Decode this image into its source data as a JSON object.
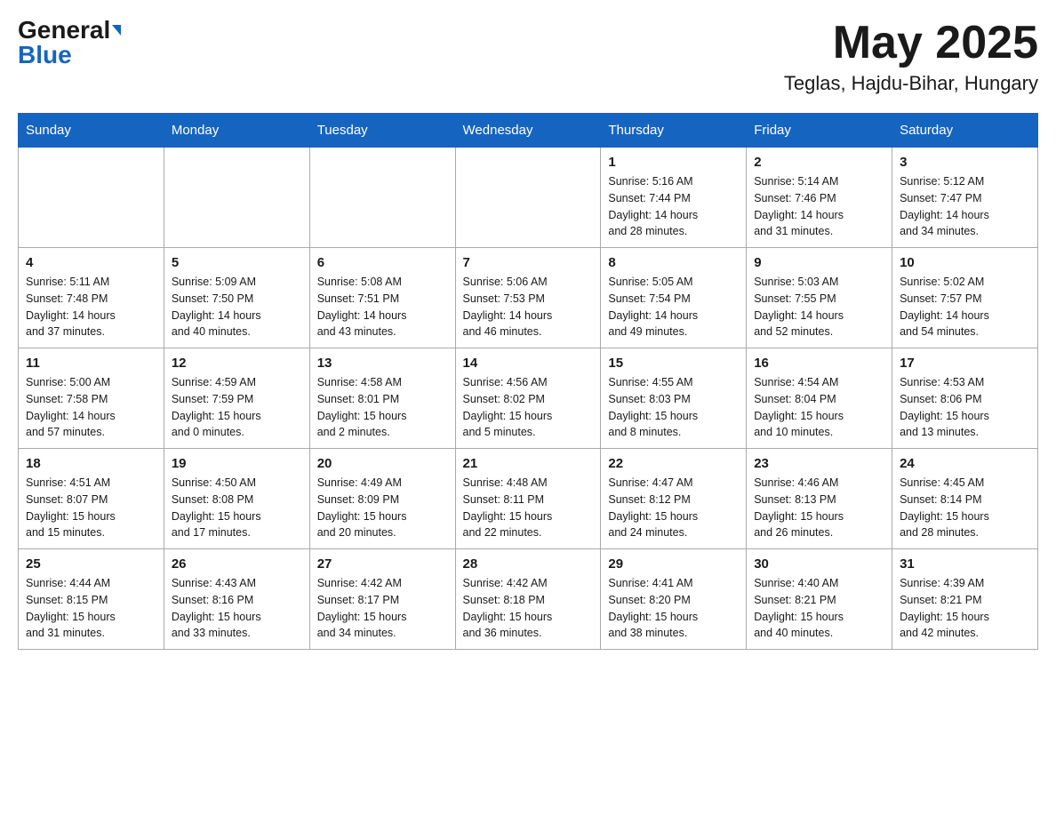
{
  "header": {
    "logo_general": "General",
    "logo_blue": "Blue",
    "month_title": "May 2025",
    "location": "Teglas, Hajdu-Bihar, Hungary"
  },
  "days_of_week": [
    "Sunday",
    "Monday",
    "Tuesday",
    "Wednesday",
    "Thursday",
    "Friday",
    "Saturday"
  ],
  "weeks": [
    [
      {
        "day": "",
        "info": ""
      },
      {
        "day": "",
        "info": ""
      },
      {
        "day": "",
        "info": ""
      },
      {
        "day": "",
        "info": ""
      },
      {
        "day": "1",
        "info": "Sunrise: 5:16 AM\nSunset: 7:44 PM\nDaylight: 14 hours\nand 28 minutes."
      },
      {
        "day": "2",
        "info": "Sunrise: 5:14 AM\nSunset: 7:46 PM\nDaylight: 14 hours\nand 31 minutes."
      },
      {
        "day": "3",
        "info": "Sunrise: 5:12 AM\nSunset: 7:47 PM\nDaylight: 14 hours\nand 34 minutes."
      }
    ],
    [
      {
        "day": "4",
        "info": "Sunrise: 5:11 AM\nSunset: 7:48 PM\nDaylight: 14 hours\nand 37 minutes."
      },
      {
        "day": "5",
        "info": "Sunrise: 5:09 AM\nSunset: 7:50 PM\nDaylight: 14 hours\nand 40 minutes."
      },
      {
        "day": "6",
        "info": "Sunrise: 5:08 AM\nSunset: 7:51 PM\nDaylight: 14 hours\nand 43 minutes."
      },
      {
        "day": "7",
        "info": "Sunrise: 5:06 AM\nSunset: 7:53 PM\nDaylight: 14 hours\nand 46 minutes."
      },
      {
        "day": "8",
        "info": "Sunrise: 5:05 AM\nSunset: 7:54 PM\nDaylight: 14 hours\nand 49 minutes."
      },
      {
        "day": "9",
        "info": "Sunrise: 5:03 AM\nSunset: 7:55 PM\nDaylight: 14 hours\nand 52 minutes."
      },
      {
        "day": "10",
        "info": "Sunrise: 5:02 AM\nSunset: 7:57 PM\nDaylight: 14 hours\nand 54 minutes."
      }
    ],
    [
      {
        "day": "11",
        "info": "Sunrise: 5:00 AM\nSunset: 7:58 PM\nDaylight: 14 hours\nand 57 minutes."
      },
      {
        "day": "12",
        "info": "Sunrise: 4:59 AM\nSunset: 7:59 PM\nDaylight: 15 hours\nand 0 minutes."
      },
      {
        "day": "13",
        "info": "Sunrise: 4:58 AM\nSunset: 8:01 PM\nDaylight: 15 hours\nand 2 minutes."
      },
      {
        "day": "14",
        "info": "Sunrise: 4:56 AM\nSunset: 8:02 PM\nDaylight: 15 hours\nand 5 minutes."
      },
      {
        "day": "15",
        "info": "Sunrise: 4:55 AM\nSunset: 8:03 PM\nDaylight: 15 hours\nand 8 minutes."
      },
      {
        "day": "16",
        "info": "Sunrise: 4:54 AM\nSunset: 8:04 PM\nDaylight: 15 hours\nand 10 minutes."
      },
      {
        "day": "17",
        "info": "Sunrise: 4:53 AM\nSunset: 8:06 PM\nDaylight: 15 hours\nand 13 minutes."
      }
    ],
    [
      {
        "day": "18",
        "info": "Sunrise: 4:51 AM\nSunset: 8:07 PM\nDaylight: 15 hours\nand 15 minutes."
      },
      {
        "day": "19",
        "info": "Sunrise: 4:50 AM\nSunset: 8:08 PM\nDaylight: 15 hours\nand 17 minutes."
      },
      {
        "day": "20",
        "info": "Sunrise: 4:49 AM\nSunset: 8:09 PM\nDaylight: 15 hours\nand 20 minutes."
      },
      {
        "day": "21",
        "info": "Sunrise: 4:48 AM\nSunset: 8:11 PM\nDaylight: 15 hours\nand 22 minutes."
      },
      {
        "day": "22",
        "info": "Sunrise: 4:47 AM\nSunset: 8:12 PM\nDaylight: 15 hours\nand 24 minutes."
      },
      {
        "day": "23",
        "info": "Sunrise: 4:46 AM\nSunset: 8:13 PM\nDaylight: 15 hours\nand 26 minutes."
      },
      {
        "day": "24",
        "info": "Sunrise: 4:45 AM\nSunset: 8:14 PM\nDaylight: 15 hours\nand 28 minutes."
      }
    ],
    [
      {
        "day": "25",
        "info": "Sunrise: 4:44 AM\nSunset: 8:15 PM\nDaylight: 15 hours\nand 31 minutes."
      },
      {
        "day": "26",
        "info": "Sunrise: 4:43 AM\nSunset: 8:16 PM\nDaylight: 15 hours\nand 33 minutes."
      },
      {
        "day": "27",
        "info": "Sunrise: 4:42 AM\nSunset: 8:17 PM\nDaylight: 15 hours\nand 34 minutes."
      },
      {
        "day": "28",
        "info": "Sunrise: 4:42 AM\nSunset: 8:18 PM\nDaylight: 15 hours\nand 36 minutes."
      },
      {
        "day": "29",
        "info": "Sunrise: 4:41 AM\nSunset: 8:20 PM\nDaylight: 15 hours\nand 38 minutes."
      },
      {
        "day": "30",
        "info": "Sunrise: 4:40 AM\nSunset: 8:21 PM\nDaylight: 15 hours\nand 40 minutes."
      },
      {
        "day": "31",
        "info": "Sunrise: 4:39 AM\nSunset: 8:21 PM\nDaylight: 15 hours\nand 42 minutes."
      }
    ]
  ]
}
